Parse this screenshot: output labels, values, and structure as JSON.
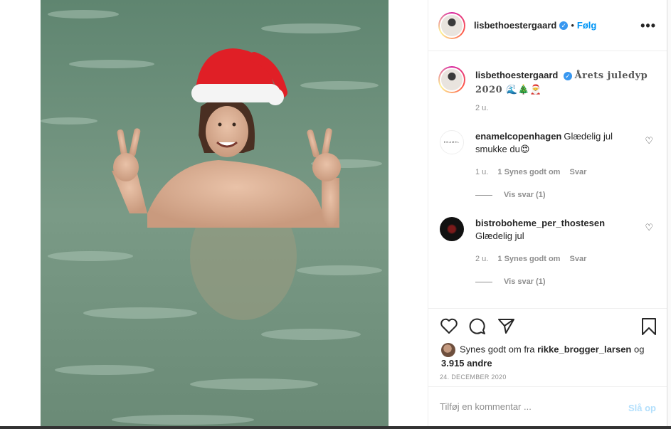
{
  "post": {
    "author": "lisbethoestergaard",
    "follow_label": "Følg",
    "separator": "•",
    "more_label": "•••"
  },
  "caption": {
    "username": "lisbethoestergaard",
    "text": "Årets juledyp 2020 🌊🎄🎅",
    "time": "2 u."
  },
  "comments": [
    {
      "username": "enamelcopenhagen",
      "text": "Glædelig jul smukke du😍",
      "time": "1 u.",
      "likes": "1 Synes godt om",
      "reply": "Svar",
      "view_replies": "Vis svar (1)",
      "avatar_text": "ENAMEL"
    },
    {
      "username": "bistroboheme_per_thostesen",
      "text": "Glædelig jul",
      "time": "2 u.",
      "likes": "1 Synes godt om",
      "reply": "Svar",
      "view_replies": "Vis svar (1)"
    }
  ],
  "likes": {
    "prefix": "Synes godt om fra",
    "liker": "rikke_brogger_larsen",
    "joiner": "og",
    "count": "3.915 andre"
  },
  "date": "24. DECEMBER 2020",
  "add_comment": {
    "placeholder": "Tilføj en kommentar ...",
    "post_label": "Slå op"
  },
  "colors": {
    "accent": "#0095f6",
    "post_disabled": "#b2dffc",
    "water": "#6f8f7c",
    "hat_red": "#e01f26"
  }
}
